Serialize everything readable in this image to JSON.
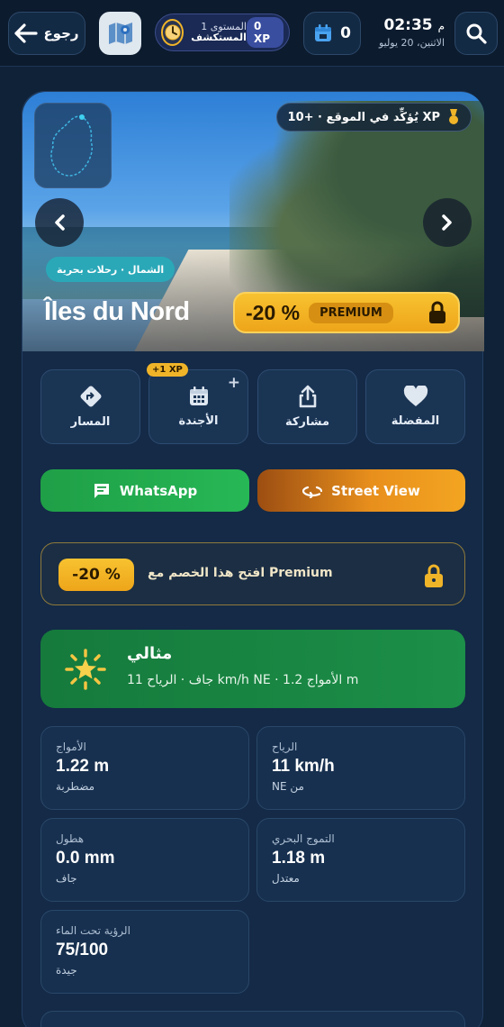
{
  "header": {
    "back_label": "رجوع",
    "level_line1": "المستوى 1",
    "level_line2": "المستكشف",
    "xp": "0 XP",
    "calendar_count": "0",
    "time": "02:35",
    "ampm": "م",
    "date": "الاثنين، 20 يوليو"
  },
  "hero": {
    "verify": "يُؤكِّد في الموقع · +10 XP",
    "region": "الشمال · رحلات بحرية",
    "title": "Îles du Nord",
    "discount": "-20 %",
    "premium": "PREMIUM"
  },
  "actions": {
    "route": "المسار",
    "agenda": "الأجندة",
    "agenda_xp": "+1 XP",
    "share": "مشاركة",
    "favorite": "المفضلة"
  },
  "buttons": {
    "whatsapp": "WhatsApp",
    "street_view": "Street View"
  },
  "promo": {
    "discount": "-20 %",
    "text": "افتح هذا الخصم مع Premium"
  },
  "condition": {
    "title": "مثالي",
    "summary": "جاف · الرياح 11 km/h NE · الأمواج 1.2 m"
  },
  "metrics": {
    "waves": {
      "label": "الأمواج",
      "value": "1.22 m",
      "sub": "مضطربة"
    },
    "wind": {
      "label": "الرياح",
      "value": "11 km/h",
      "sub": "NE من"
    },
    "rain": {
      "label": "هطول",
      "value": "0.0 mm",
      "sub": "جاف"
    },
    "swell": {
      "label": "التموج البحري",
      "value": "1.18 m",
      "sub": "معتدل"
    },
    "visibility": {
      "label": "الرؤية تحت الماء",
      "value": "75/100",
      "sub": "جيدة"
    }
  },
  "colors": {
    "background": "#0f2238",
    "accent_gold": "#f0b429",
    "whatsapp_green": "#27b856",
    "street_view_orange": "#e88f1c",
    "condition_green": "#1c8f48"
  },
  "icons": [
    "back-arrow-icon",
    "map-icon",
    "clock-icon",
    "calendar-icon",
    "search-icon",
    "medal-icon",
    "chevron-left-icon",
    "chevron-right-icon",
    "lock-icon",
    "directions-icon",
    "share-icon",
    "heart-icon",
    "chat-icon",
    "street-view-icon",
    "sun-icon"
  ]
}
